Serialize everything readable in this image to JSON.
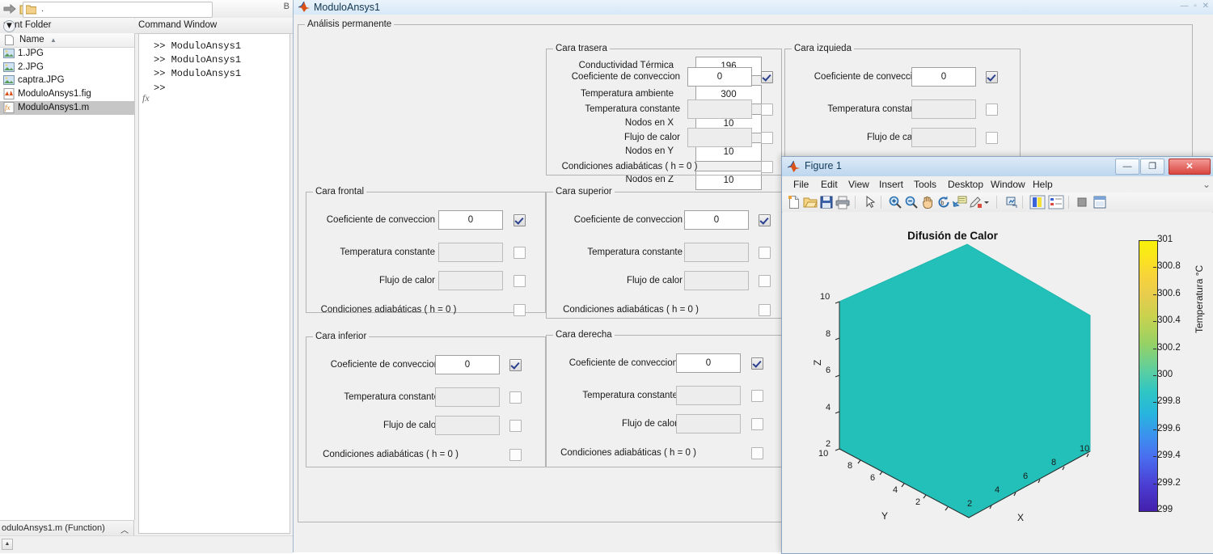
{
  "desktop": {
    "toolbar": {
      "address_value": ".",
      "right_hint": "B",
      "icons": [
        "forward-arrow-icon",
        "new-folder-icon",
        "browse-folder-icon",
        "folder-icon"
      ]
    },
    "current_folder": {
      "panel_title": "rrent Folder",
      "column_header": "Name",
      "sort_arrow": "▲",
      "files": [
        {
          "label": "1.JPG",
          "icon": "image-file-icon",
          "selected": false
        },
        {
          "label": "2.JPG",
          "icon": "image-file-icon",
          "selected": false
        },
        {
          "label": "captra.JPG",
          "icon": "image-file-icon",
          "selected": false
        },
        {
          "label": "ModuloAnsys1.fig",
          "icon": "matlab-fig-file-icon",
          "selected": false
        },
        {
          "label": "ModuloAnsys1.m",
          "icon": "matlab-m-file-icon",
          "selected": true
        }
      ],
      "status_text": "oduloAnsys1.m  (Function)",
      "status_chevron": "︿"
    },
    "command_window": {
      "panel_title": "Command Window",
      "lines": [
        ">> ModuloAnsys1",
        ">> ModuloAnsys1",
        ">> ModuloAnsys1",
        ">>"
      ],
      "fx_glyph": "fx"
    }
  },
  "gui": {
    "title": "ModuloAnsys1",
    "titlebar_icon": "matlab-icon",
    "window_controls": "— ▫ ✕",
    "main_group": {
      "label": "Análisis permanente",
      "fields": [
        {
          "label": "Conductividad Térmica",
          "value": "196"
        },
        {
          "label": "Temperatura ambiente",
          "value": "300"
        },
        {
          "label": "Nodos en X",
          "value": "10"
        },
        {
          "label": "Nodos en Y",
          "value": "10"
        },
        {
          "label": "Nodos en Z",
          "value": "10"
        }
      ]
    },
    "row_labels": {
      "conveccion": "Coeficiente de conveccion",
      "temperatura": "Temperatura constante",
      "flujo": "Flujo de calor",
      "adiabaticas": "Condiciones adiabáticas ( h = 0 )"
    },
    "faces": [
      {
        "id": "cara-frontal",
        "label": "Cara frontal",
        "conveccion_value": "0",
        "conveccion_checked": true,
        "temperatura_value": "",
        "temperatura_checked": false,
        "flujo_value": "",
        "flujo_checked": false,
        "adiabaticas_checked": false
      },
      {
        "id": "cara-inferior",
        "label": "Cara inferior",
        "conveccion_value": "0",
        "conveccion_checked": true,
        "temperatura_value": "",
        "temperatura_checked": false,
        "flujo_value": "",
        "flujo_checked": false,
        "adiabaticas_checked": false
      },
      {
        "id": "cara-trasera",
        "label": "Cara trasera",
        "conveccion_value": "0",
        "conveccion_checked": true,
        "temperatura_value": "",
        "temperatura_checked": false,
        "flujo_value": "",
        "flujo_checked": false,
        "adiabaticas_checked": false
      },
      {
        "id": "cara-superior",
        "label": "Cara superior",
        "conveccion_value": "0",
        "conveccion_checked": true,
        "temperatura_value": "",
        "temperatura_checked": false,
        "flujo_value": "",
        "flujo_checked": false,
        "adiabaticas_checked": false
      },
      {
        "id": "cara-derecha",
        "label": "Cara derecha",
        "conveccion_value": "0",
        "conveccion_checked": true,
        "temperatura_value": "",
        "temperatura_checked": false,
        "flujo_value": "",
        "flujo_checked": false,
        "adiabaticas_checked": false
      },
      {
        "id": "cara-izquierda",
        "label": "Cara izquieda",
        "conveccion_value": "0",
        "conveccion_checked": true,
        "temperatura_value": "",
        "temperatura_checked": false,
        "flujo_value": "",
        "flujo_checked": false,
        "adiabaticas_checked": false
      }
    ]
  },
  "figure": {
    "title": "Figure 1",
    "titlebar_icon": "matlab-icon",
    "window_buttons": {
      "minimize": "—",
      "maximize": "❐",
      "close": "✕"
    },
    "menus": [
      "File",
      "Edit",
      "View",
      "Insert",
      "Tools",
      "Desktop",
      "Window",
      "Help"
    ],
    "toolbar_icons": [
      "new-figure-icon",
      "open-file-icon",
      "save-figure-icon",
      "print-icon",
      "pointer-icon",
      "zoom-in-icon",
      "zoom-out-icon",
      "pan-icon",
      "rotate-3d-icon",
      "data-cursor-icon",
      "brush-icon",
      "chevron-down-icon",
      "link-plot-icon",
      "colorbar-icon",
      "legend-icon",
      "hide-plot-tools-icon",
      "show-plot-tools-icon"
    ]
  },
  "chart_data": {
    "type": "surface",
    "title": "Difusión de Calor",
    "xlabel": "X",
    "ylabel": "Y",
    "zlabel": "Z",
    "xlim": [
      0,
      10
    ],
    "ylim": [
      0,
      10
    ],
    "zlim": [
      0,
      10
    ],
    "xticks": [
      "2",
      "4",
      "6",
      "8",
      "10"
    ],
    "yticks": [
      "2",
      "4",
      "6",
      "8",
      "10"
    ],
    "zticks": [
      "2",
      "4",
      "6",
      "8",
      "10"
    ],
    "y_origin_tick": "10",
    "grid": false,
    "view": "3d-isometric",
    "surface_color": "#22c0b8",
    "uniform_value": 300,
    "colorbar": {
      "label": "Temperatura °C",
      "min": 299,
      "max": 301,
      "ticks": [
        "301",
        "300.8",
        "300.6",
        "300.4",
        "300.2",
        "300",
        "299.8",
        "299.6",
        "299.4",
        "299.2",
        "299"
      ],
      "colormap": "parula",
      "position": "right"
    }
  },
  "colors": {
    "surface": "#22c0b8",
    "figure_bg": "#f0f0f0",
    "titlebar": "#d7e8f7",
    "selection": "#c6c6c6",
    "close_button": "#d9453f"
  }
}
